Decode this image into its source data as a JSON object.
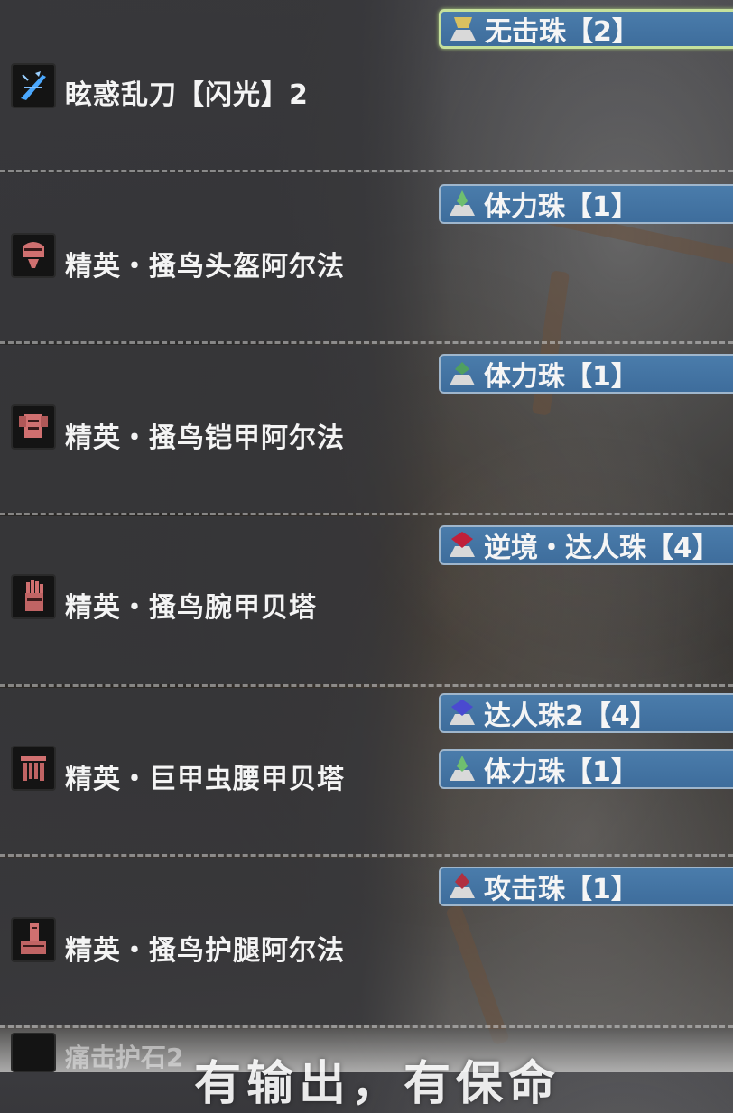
{
  "items": [
    {
      "name": "眩惑乱刀【闪光】2",
      "icon": "dual-blades-icon",
      "decorations": [
        {
          "label": "无击珠【2】",
          "gem": "attack-gem-yellow-icon",
          "gem_color": "#d8c060"
        }
      ]
    },
    {
      "name": "精英・搔鸟头盔阿尔法",
      "icon": "helmet-icon",
      "decorations": [
        {
          "label": "体力珠【1】",
          "gem": "health-gem-green-icon",
          "gem_color": "#6fbf6f"
        }
      ]
    },
    {
      "name": "精英・搔鸟铠甲阿尔法",
      "icon": "chest-armor-icon",
      "decorations": [
        {
          "label": "体力珠【1】",
          "gem": "health-gem-green-icon",
          "gem_color": "#4f9f5f"
        }
      ]
    },
    {
      "name": "精英・搔鸟腕甲贝塔",
      "icon": "gauntlet-icon",
      "decorations": [
        {
          "label": "逆境・达人珠【4】",
          "gem": "critical-gem-red-icon",
          "gem_color": "#c0203a"
        }
      ]
    },
    {
      "name": "精英・巨甲虫腰甲贝塔",
      "icon": "waist-armor-icon",
      "decorations": [
        {
          "label": "达人珠2【4】",
          "gem": "expert-gem-blue-icon",
          "gem_color": "#4a4ad0"
        },
        {
          "label": "体力珠【1】",
          "gem": "health-gem-green-icon",
          "gem_color": "#6fbf6f"
        }
      ]
    },
    {
      "name": "精英・搔鸟护腿阿尔法",
      "icon": "leg-armor-icon",
      "decorations": [
        {
          "label": "攻击珠【1】",
          "gem": "attack-gem-red-icon",
          "gem_color": "#b03040"
        }
      ]
    }
  ],
  "charm": {
    "name": "痛击护石2",
    "icon": "charm-icon"
  },
  "subtitle": "有输出，有保命",
  "colors": {
    "deco_bg": "#4378a8",
    "panel": "#37373a",
    "icon_accent": "#d07070"
  }
}
